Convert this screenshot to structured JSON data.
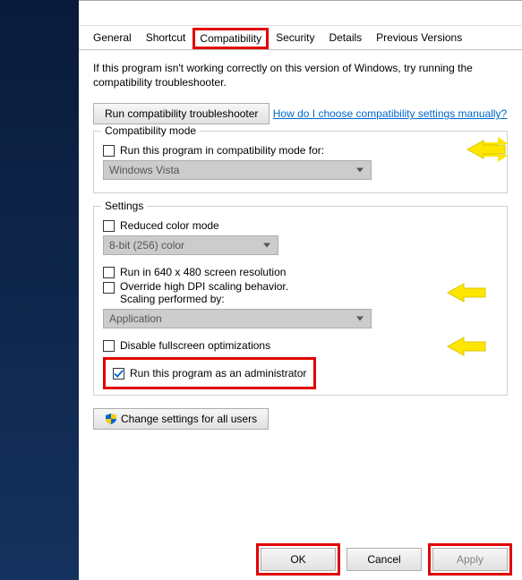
{
  "tabs": {
    "general": "General",
    "shortcut": "Shortcut",
    "compatibility": "Compatibility",
    "security": "Security",
    "details": "Details",
    "prev": "Previous Versions"
  },
  "intro": "If this program isn't working correctly on this version of Windows, try running the compatibility troubleshooter.",
  "troubleshoot_btn": "Run compatibility troubleshooter",
  "help_link": "How do I choose compatibility settings manually?",
  "compat": {
    "title": "Compatibility mode",
    "run_label": "Run this program in compatibility mode for:",
    "select_value": "Windows Vista"
  },
  "settings": {
    "title": "Settings",
    "reduced_color": "Reduced color mode",
    "color_select": "8-bit (256) color",
    "low_res": "Run in 640 x 480 screen resolution",
    "dpi_override": "Override high DPI scaling behavior.\nScaling performed by:",
    "dpi_select": "Application",
    "disable_fs": "Disable fullscreen optimizations",
    "run_admin": "Run this program as an administrator"
  },
  "change_all": "Change settings for all users",
  "buttons": {
    "ok": "OK",
    "cancel": "Cancel",
    "apply": "Apply"
  }
}
